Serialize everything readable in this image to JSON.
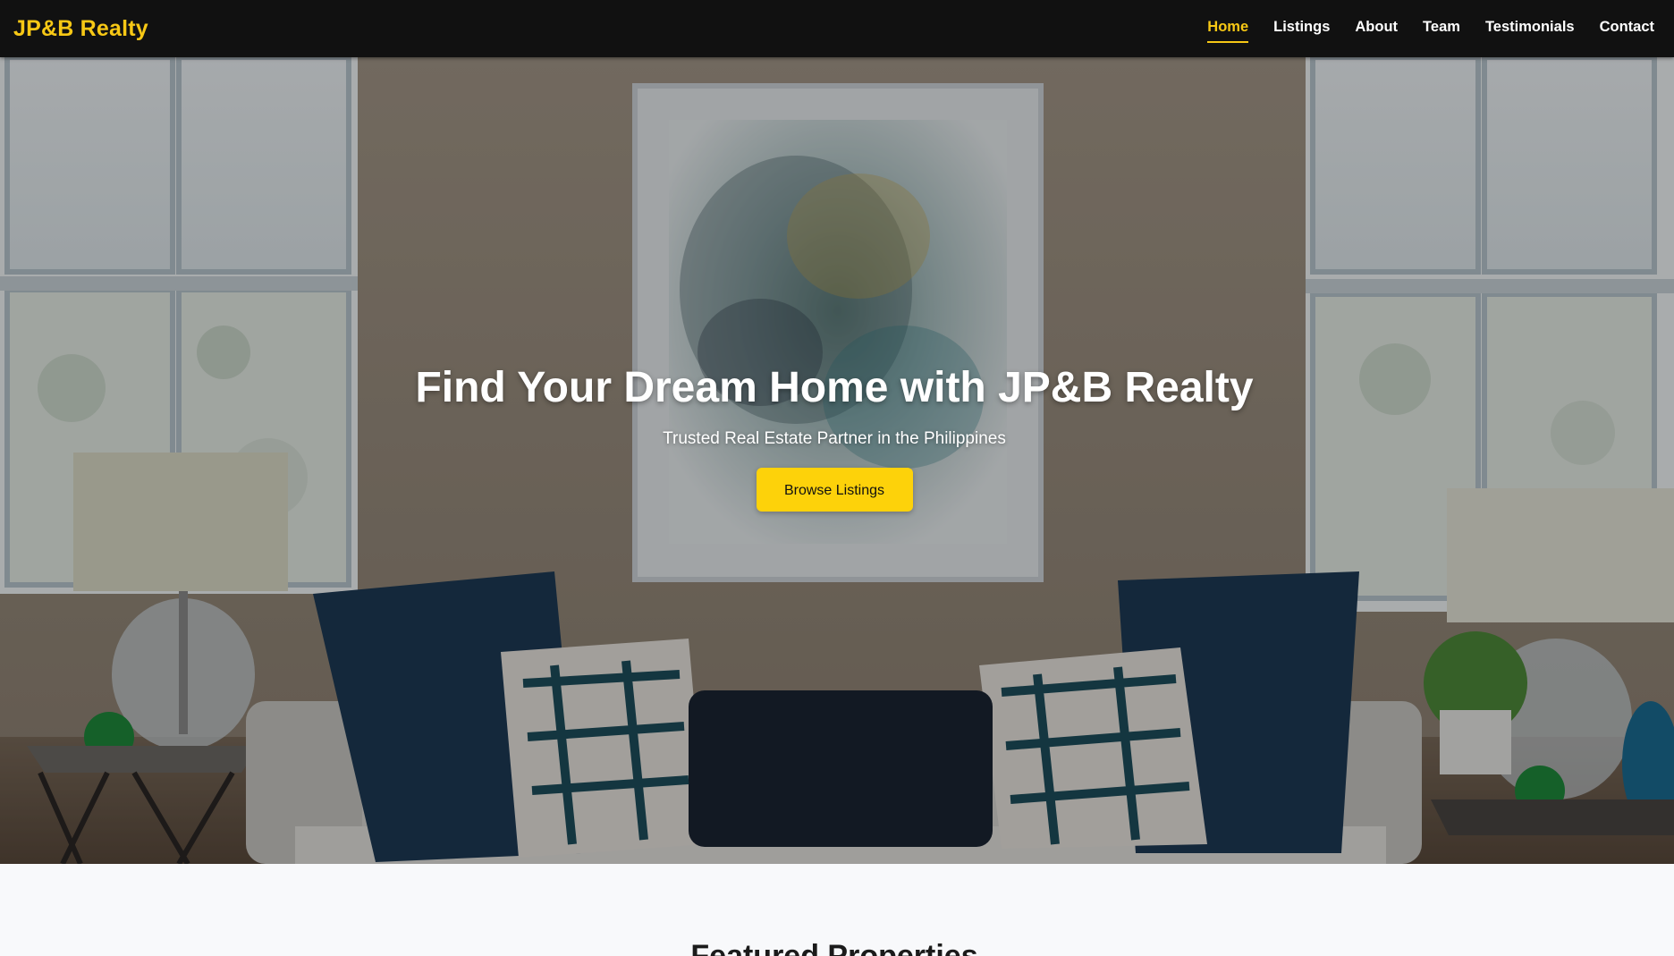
{
  "brand": "JP&B Realty",
  "nav": [
    {
      "label": "Home",
      "active": true
    },
    {
      "label": "Listings",
      "active": false
    },
    {
      "label": "About",
      "active": false
    },
    {
      "label": "Team",
      "active": false
    },
    {
      "label": "Testimonials",
      "active": false
    },
    {
      "label": "Contact",
      "active": false
    }
  ],
  "hero": {
    "title": "Find Your Dream Home with JP&B Realty",
    "subtitle": "Trusted Real Estate Partner in the Philippines",
    "button_label": "Browse Listings"
  },
  "featured": {
    "title": "Featured Properties"
  },
  "colors": {
    "navbar_bg": "#111111",
    "accent": "#f7c815",
    "button_bg": "#fdd20a",
    "page_bg": "#f8f9fb"
  }
}
